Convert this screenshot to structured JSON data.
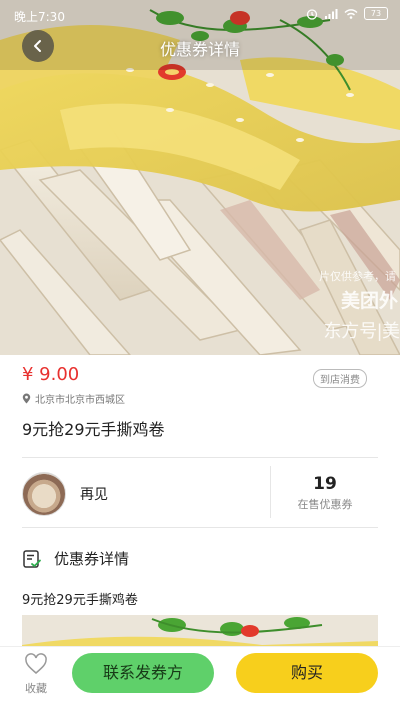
{
  "status_bar": {
    "time": "晚上7:30",
    "battery": "73"
  },
  "header": {
    "title": "优惠券详情"
  },
  "hero": {
    "watermark_line1": "片仅供参考，请",
    "watermark_line2": "美团外",
    "watermark_line3": "东方号|美"
  },
  "deal": {
    "price": "¥ 9.00",
    "tag": "到店消费",
    "location": "北京市北京市西城区",
    "title": "9元抢29元手撕鸡卷"
  },
  "shop": {
    "name": "再见",
    "coupon_count": "19",
    "coupon_count_label": "在售优惠券"
  },
  "details": {
    "header": "优惠券详情",
    "description": "9元抢29元手撕鸡卷"
  },
  "bottom_bar": {
    "favorite_label": "收藏",
    "contact_label": "联系发券方",
    "buy_label": "购买"
  },
  "colors": {
    "price": "#e8312f",
    "contact_button": "#5fd06a",
    "buy_button": "#f7cf1c"
  }
}
